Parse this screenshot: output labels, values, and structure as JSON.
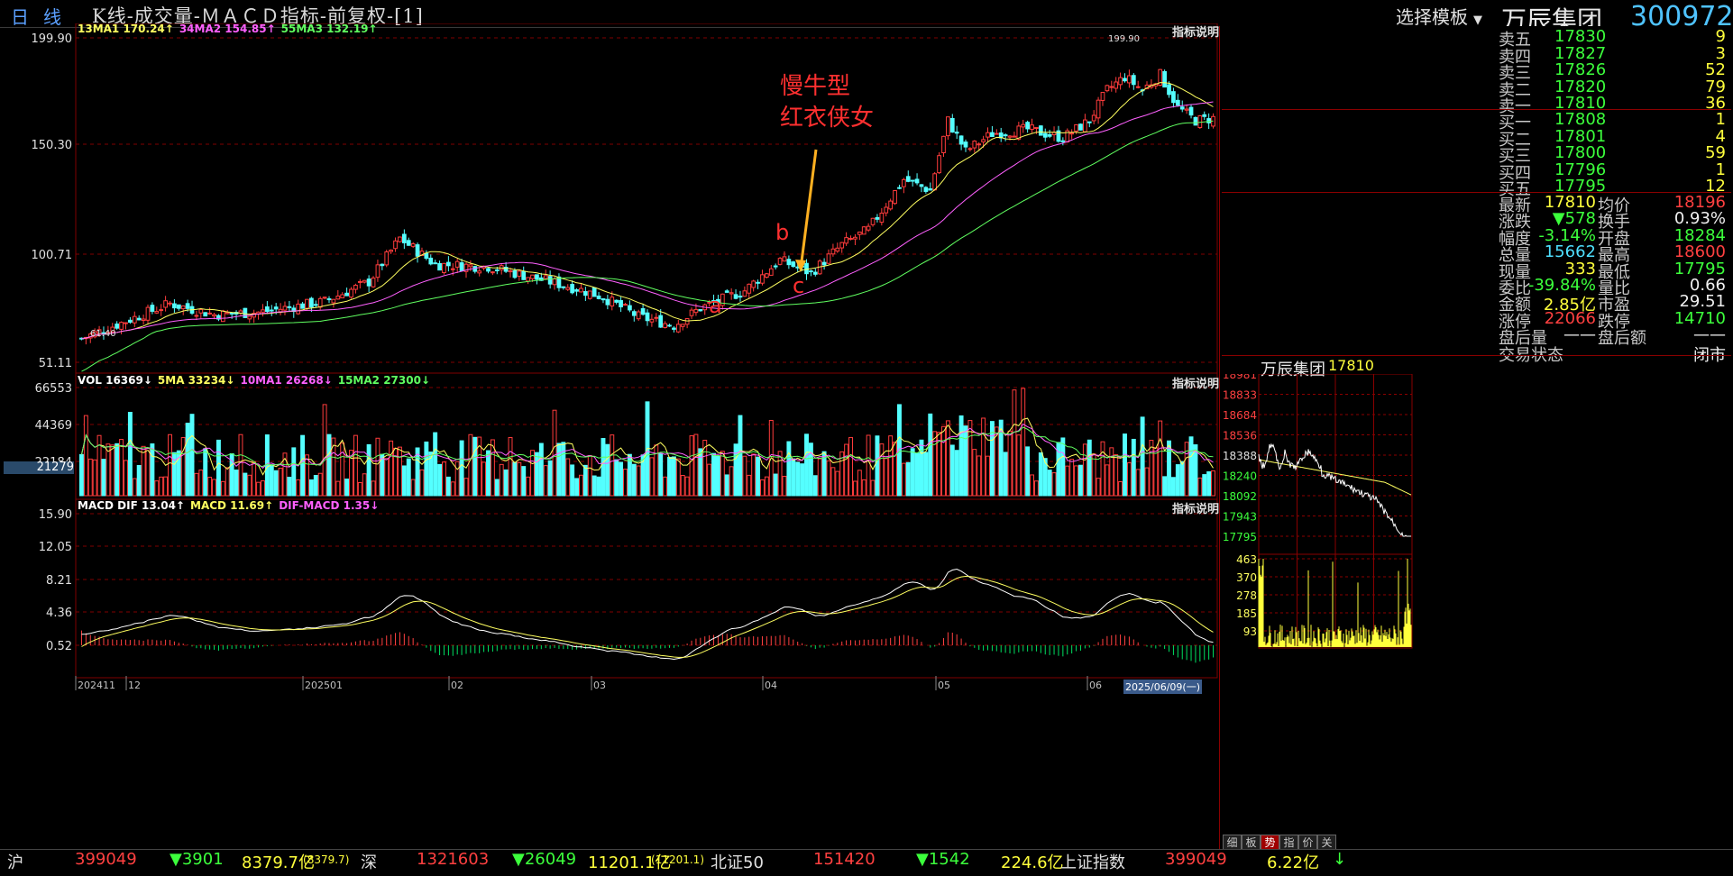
{
  "header": {
    "period_label_1": "日",
    "period_label_2": "线",
    "title": "K线-成交量-ＭＡＣＤ指标-前复权-[1]",
    "template_button": "选择模板",
    "stock_name": "万辰集团",
    "stock_code": "300972"
  },
  "kline_panel": {
    "ma_legend": [
      {
        "text": "13MA1 170.24↑",
        "color": "#ffff60"
      },
      {
        "text": "34MA2 154.85↑",
        "color": "#ff60ff"
      },
      {
        "text": "55MA3 132.19↑",
        "color": "#60ff60"
      }
    ],
    "help": "指标说明",
    "y_labels": [
      "199.90",
      "150.30",
      "100.71",
      "51.11"
    ],
    "annotations": {
      "title1": "慢牛型",
      "title2": "红衣侠女",
      "a": "a",
      "b": "b",
      "c": "c",
      "high": "199.90",
      "low": "61.40"
    }
  },
  "vol_panel": {
    "legend": [
      {
        "text": "VOL 16369↓",
        "color": "#ffffff"
      },
      {
        "text": "5MA 33234↓",
        "color": "#ffff60"
      },
      {
        "text": "10MA1 26268↓",
        "color": "#ff60ff"
      },
      {
        "text": "15MA2 27300↓",
        "color": "#60ff60"
      }
    ],
    "help": "指标说明",
    "y_labels": [
      "66553",
      "44369",
      "22184"
    ],
    "current": "21279"
  },
  "macd_panel": {
    "legend": [
      {
        "text": "MACD DIF 13.04↑",
        "color": "#ffffff"
      },
      {
        "text": "MACD 11.69↑",
        "color": "#ffff60"
      },
      {
        "text": "DIF-MACD 1.35↓",
        "color": "#ff60ff"
      }
    ],
    "help": "指标说明",
    "y_labels": [
      "15.90",
      "12.05",
      "8.21",
      "4.36",
      "0.52"
    ]
  },
  "x_axis": {
    "labels": [
      "202411",
      "12",
      "202501",
      "02",
      "03",
      "04",
      "05",
      "06"
    ],
    "cursor_date": "2025/06/09(一)"
  },
  "order_book": {
    "sell": [
      {
        "label": "卖五",
        "price": "17830",
        "vol": "9"
      },
      {
        "label": "卖四",
        "price": "17827",
        "vol": "3"
      },
      {
        "label": "卖三",
        "price": "17826",
        "vol": "52"
      },
      {
        "label": "卖二",
        "price": "17820",
        "vol": "79"
      },
      {
        "label": "卖一",
        "price": "17810",
        "vol": "36"
      }
    ],
    "buy": [
      {
        "label": "买一",
        "price": "17808",
        "vol": "1"
      },
      {
        "label": "买二",
        "price": "17801",
        "vol": "4"
      },
      {
        "label": "买三",
        "price": "17800",
        "vol": "59"
      },
      {
        "label": "买四",
        "price": "17796",
        "vol": "1"
      },
      {
        "label": "买五",
        "price": "17795",
        "vol": "12"
      }
    ]
  },
  "stats": [
    {
      "l1": "最新",
      "v1": "17810",
      "c1": "yel",
      "l2": "均价",
      "v2": "18196",
      "c2": "red"
    },
    {
      "l1": "涨跌",
      "v1": "▼578",
      "c1": "grn",
      "l2": "换手",
      "v2": "0.93%",
      "c2": "wht"
    },
    {
      "l1": "幅度",
      "v1": "-3.14%",
      "c1": "grn",
      "l2": "开盘",
      "v2": "18284",
      "c2": "grn"
    },
    {
      "l1": "总量",
      "v1": "15662",
      "c1": "cyn",
      "l2": "最高",
      "v2": "18600",
      "c2": "red"
    },
    {
      "l1": "现量",
      "v1": "333",
      "c1": "yel",
      "l2": "最低",
      "v2": "17795",
      "c2": "grn"
    },
    {
      "l1": "委比",
      "v1": "-39.84%",
      "c1": "grn",
      "l2": "量比",
      "v2": "0.66",
      "c2": "wht"
    },
    {
      "l1": "金额",
      "v1": "2.85亿",
      "c1": "yel",
      "l2": "市盈",
      "v2": "29.51",
      "c2": "wht"
    },
    {
      "l1": "涨停",
      "v1": "22066",
      "c1": "red",
      "l2": "跌停",
      "v2": "14710",
      "c2": "grn"
    },
    {
      "l1": "盘后量",
      "v1": "——",
      "c1": "wht",
      "l2": "盘后额",
      "v2": "——",
      "c2": "wht"
    }
  ],
  "trade_status": {
    "label": "交易状态",
    "value": "闭市"
  },
  "mini_chart": {
    "name": "万辰集团",
    "price": "17810",
    "price_labels": [
      "18981",
      "18833",
      "18684",
      "18536",
      "18388",
      "18240",
      "18092",
      "17943",
      "17795"
    ],
    "vol_labels": [
      "463",
      "370",
      "278",
      "185",
      "93"
    ],
    "tabs": [
      "细",
      "板",
      "势",
      "指",
      "价",
      "关"
    ]
  },
  "bottom_bar": {
    "sh_label": "沪",
    "sh_val": "399049",
    "sh_chg": "▼3901",
    "sh_amt": "8379.7亿",
    "sh_amt2": "8379.7",
    "sz_label": "深",
    "sz_val": "1321603",
    "sz_chg": "▼26049",
    "sz_amt": "11201.1亿",
    "sz_amt2": "11201.1",
    "bj_label": "北证50",
    "bj_val": "151420",
    "bj_chg": "▼1542",
    "bj_amt": "224.6亿",
    "idx_label": "上证指数",
    "idx_val": "399049",
    "idx_amt": "6.22亿",
    "idx_arrow": "↓"
  },
  "colors": {
    "up": "#ff3c3c",
    "down": "#54ffff",
    "ma1": "#ffff60",
    "ma2": "#ff60ff",
    "ma3": "#60ff60",
    "grid": "#800000",
    "annot": "#ff3030",
    "arrow": "#ffb020"
  }
}
